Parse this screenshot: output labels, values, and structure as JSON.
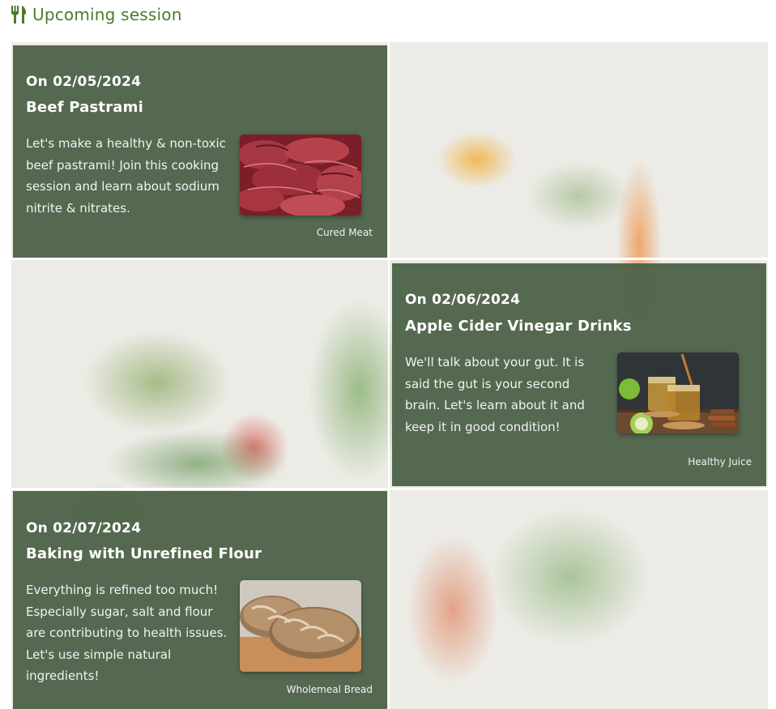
{
  "header": {
    "icon": "fork-knife-icon",
    "title": "Upcoming session",
    "accent_color": "#4d7a2a"
  },
  "sessions": [
    {
      "date": "On 02/05/2024",
      "title": "Beef Pastrami",
      "description": "Let's make a healthy & non-toxic beef pastrami! Join this cooking session and learn about sodium nitrite & nitrates.",
      "image_caption": "Cured Meat"
    },
    {
      "date": "On 02/06/2024",
      "title": "Apple Cider Vinegar Drinks",
      "description": "We'll talk about your gut. It is said the gut is your second brain. Let's learn about it and keep it in good condition!",
      "image_caption": "Healthy Juice"
    },
    {
      "date": "On 02/07/2024",
      "title": "Baking with Unrefined Flour",
      "description": "Everything is refined too much! Especially sugar, salt and flour are contributing to health issues. Let's use simple natural ingredients!",
      "image_caption": "Wholemeal Bread"
    }
  ],
  "card_color": "#495f44"
}
